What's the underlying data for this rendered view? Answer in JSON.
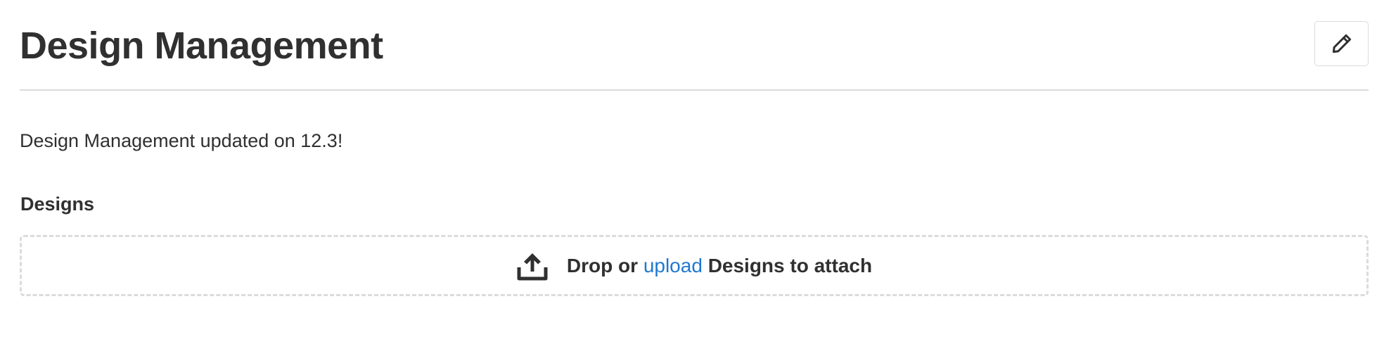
{
  "header": {
    "title": "Design Management",
    "edit_icon": "pencil-icon"
  },
  "description": "Design Management updated on 12.3!",
  "designs": {
    "label": "Designs",
    "dropzone": {
      "icon": "upload-icon",
      "prefix": "Drop or",
      "link_label": "upload",
      "suffix": "Designs to attach"
    }
  },
  "colors": {
    "text": "#303030",
    "link": "#1f78d1",
    "border": "#dbdbdb"
  }
}
